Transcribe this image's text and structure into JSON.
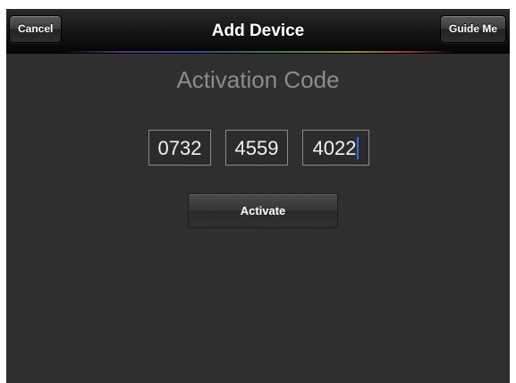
{
  "navbar": {
    "title": "Add Device",
    "cancel_label": "Cancel",
    "guide_label": "Guide Me"
  },
  "main": {
    "heading": "Activation Code",
    "code_fields": [
      "0732",
      "4559",
      "4022"
    ],
    "activate_label": "Activate"
  },
  "colors": {
    "background": "#2e2e2e",
    "caret": "#2f6fe8",
    "heading_text": "#8c8c8c"
  }
}
